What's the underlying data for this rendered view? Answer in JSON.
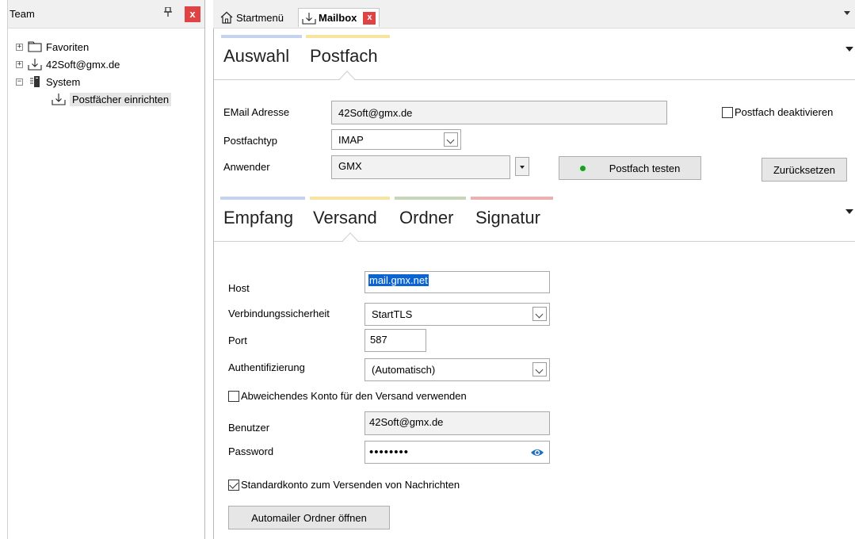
{
  "team_panel": {
    "title": "Team",
    "pin_glyph": "ᵘ",
    "close_glyph": "x",
    "tree": [
      {
        "expander": "+",
        "icon": "folder-icon",
        "label": "Favoriten"
      },
      {
        "expander": "+",
        "icon": "mailbox-icon",
        "label": "42Soft@gmx.de"
      },
      {
        "expander": "−",
        "icon": "server-icon",
        "label": "System"
      },
      {
        "icon": "mailbox-icon",
        "label": "Postfächer einrichten",
        "selected": true
      }
    ]
  },
  "tabs": [
    {
      "icon": "home-icon",
      "label": "Startmenü"
    },
    {
      "icon": "mailbox-icon",
      "label": "Mailbox",
      "active": true,
      "close_glyph": "x"
    }
  ],
  "top_section": {
    "tabs": [
      {
        "label": "Auswahl",
        "color": "#c5d3ee"
      },
      {
        "label": "Postfach",
        "color": "#f6e4a0",
        "active": true
      }
    ],
    "email_label": "EMail Adresse",
    "email_value": "42Soft@gmx.de",
    "deactivate_label": "Postfach deaktivieren",
    "type_label": "Postfachtyp",
    "type_value": "IMAP",
    "user_label": "Anwender",
    "user_value": "GMX",
    "test_button": "Postfach testen",
    "reset_button": "Zurücksetzen"
  },
  "sub_section": {
    "tabs": [
      {
        "label": "Empfang",
        "color": "#c5d3ee"
      },
      {
        "label": "Versand",
        "color": "#f6e4a0",
        "active": true
      },
      {
        "label": "Ordner",
        "color": "#c7d6b8"
      },
      {
        "label": "Signatur",
        "color": "#ecb0b0"
      }
    ],
    "host_label": "Host",
    "host_value": "mail.gmx.net",
    "security_label": "Verbindungssicherheit",
    "security_value": "StartTLS",
    "port_label": "Port",
    "port_value": "587",
    "auth_label": "Authentifizierung",
    "auth_value": "(Automatisch)",
    "alt_account_label": "Abweichendes Konto für den Versand verwenden",
    "alt_account_checked": false,
    "username_label": "Benutzer",
    "username_value": "42Soft@gmx.de",
    "password_label": "Password",
    "password_value": "••••••••",
    "default_account_label": "Standardkonto zum Versenden von Nachrichten",
    "default_account_checked": true,
    "open_folder_button": "Automailer Ordner öffnen"
  }
}
